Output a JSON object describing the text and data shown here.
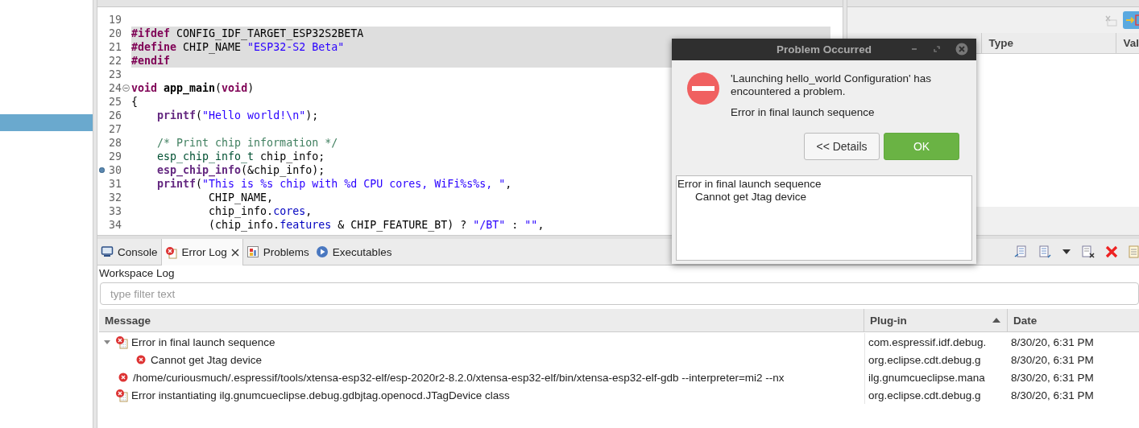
{
  "sidebar": {
    "rows": [
      {
        "selected": false
      },
      {
        "selected": false
      },
      {
        "selected": false
      },
      {
        "selected": false
      },
      {
        "selected": false
      },
      {
        "selected": false
      },
      {
        "selected": true
      }
    ]
  },
  "editor": {
    "lines": [
      {
        "number": "19",
        "highlighted": false
      },
      {
        "number": "20",
        "highlighted": true,
        "tokens": [
          {
            "kind": "keyword",
            "text": "#ifdef"
          },
          {
            "kind": "plain",
            "text": " CONFIG_IDF_TARGET_ESP32S2BETA"
          }
        ]
      },
      {
        "number": "21",
        "highlighted": true,
        "tokens": [
          {
            "kind": "keyword",
            "text": "#define"
          },
          {
            "kind": "plain",
            "text": " CHIP_NAME "
          },
          {
            "kind": "string",
            "text": "\"ESP32-S2 Beta\""
          }
        ]
      },
      {
        "number": "22",
        "highlighted": true,
        "tokens": [
          {
            "kind": "keyword",
            "text": "#endif"
          }
        ]
      },
      {
        "number": "23",
        "highlighted": false
      },
      {
        "number": "24",
        "highlighted": false,
        "collapsible": true,
        "tokens": [
          {
            "kind": "keyword",
            "text": "void"
          },
          {
            "kind": "decl",
            "text": " app_main"
          },
          {
            "kind": "plain",
            "text": "("
          },
          {
            "kind": "keyword",
            "text": "void"
          },
          {
            "kind": "plain",
            "text": ")"
          }
        ]
      },
      {
        "number": "25",
        "highlighted": false,
        "tokens": [
          {
            "kind": "plain",
            "text": "{"
          }
        ]
      },
      {
        "number": "26",
        "highlighted": false,
        "tokens": [
          {
            "kind": "func",
            "text": "    printf"
          },
          {
            "kind": "plain",
            "text": "("
          },
          {
            "kind": "string",
            "text": "\"Hello world!\\n\""
          },
          {
            "kind": "plain",
            "text": ");"
          }
        ]
      },
      {
        "number": "27",
        "highlighted": false
      },
      {
        "number": "28",
        "highlighted": false,
        "tokens": [
          {
            "kind": "comment",
            "text": "    /* Print chip information */"
          }
        ]
      },
      {
        "number": "29",
        "highlighted": false,
        "tokens": [
          {
            "kind": "type",
            "text": "    esp_chip_info_t"
          },
          {
            "kind": "plain",
            "text": " chip_info;"
          }
        ]
      },
      {
        "number": "30",
        "highlighted": false,
        "bookmark": true,
        "tokens": [
          {
            "kind": "func",
            "text": "    esp_chip_info"
          },
          {
            "kind": "plain",
            "text": "(&chip_info);"
          }
        ]
      },
      {
        "number": "31",
        "highlighted": false,
        "tokens": [
          {
            "kind": "func",
            "text": "    printf"
          },
          {
            "kind": "plain",
            "text": "("
          },
          {
            "kind": "string",
            "text": "\"This is %s chip with %d CPU cores, WiFi%s%s, \""
          },
          {
            "kind": "plain",
            "text": ","
          }
        ]
      },
      {
        "number": "32",
        "highlighted": false,
        "tokens": [
          {
            "kind": "plain",
            "text": "            CHIP_NAME,"
          }
        ]
      },
      {
        "number": "33",
        "highlighted": false,
        "tokens": [
          {
            "kind": "plain",
            "text": "            chip_info."
          },
          {
            "kind": "field",
            "text": "cores"
          },
          {
            "kind": "plain",
            "text": ","
          }
        ]
      },
      {
        "number": "34",
        "highlighted": false,
        "tokens": [
          {
            "kind": "plain",
            "text": "            (chip_info."
          },
          {
            "kind": "field",
            "text": "features"
          },
          {
            "kind": "plain",
            "text": " & CHIP_FEATURE_BT) ? "
          },
          {
            "kind": "string",
            "text": "\"/BT\""
          },
          {
            "kind": "plain",
            "text": " : "
          },
          {
            "kind": "string",
            "text": "\"\""
          },
          {
            "kind": "plain",
            "text": ","
          }
        ]
      }
    ]
  },
  "right_panel": {
    "columns": [
      "Type",
      "Val"
    ]
  },
  "bottom_panel": {
    "tabs": [
      {
        "label": "Console",
        "selected": false,
        "closable": false
      },
      {
        "label": "Error Log",
        "selected": true,
        "closable": true
      },
      {
        "label": "Problems",
        "selected": false,
        "closable": false
      },
      {
        "label": "Executables",
        "selected": false,
        "closable": false
      }
    ],
    "log_title": "Workspace Log",
    "filter": {
      "placeholder": "type filter text"
    },
    "columns": [
      {
        "label": "Message",
        "sorted": false
      },
      {
        "label": "Plug-in",
        "sorted": true
      },
      {
        "label": "Date",
        "sorted": false
      }
    ],
    "rows": [
      {
        "kind": "session",
        "message": "Error in final launch sequence",
        "plugin": "com.espressif.idf.debug.",
        "date": "8/30/20, 6:31 PM",
        "expanded": true,
        "children": [
          {
            "kind": "error",
            "message": "Cannot get Jtag device",
            "plugin": "org.eclipse.cdt.debug.g",
            "date": "8/30/20, 6:31 PM"
          }
        ]
      },
      {
        "kind": "error",
        "message": "/home/curiousmuch/.espressif/tools/xtensa-esp32-elf/esp-2020r2-8.2.0/xtensa-esp32-elf/bin/xtensa-esp32-elf-gdb --interpreter=mi2 --nx",
        "plugin": "ilg.gnumcueclipse.mana",
        "date": "8/30/20, 6:31 PM"
      },
      {
        "kind": "session",
        "message": "Error instantiating ilg.gnumcueclipse.debug.gdbjtag.openocd.JTagDevice class",
        "plugin": "org.eclipse.cdt.debug.g",
        "date": "8/30/20, 6:31 PM"
      }
    ]
  },
  "dialog": {
    "title": "Problem Occurred",
    "message": "'Launching hello_world Configuration' has encountered a problem.",
    "reason": "Error in final launch sequence",
    "buttons": [
      {
        "label": "<< Details",
        "kind": "secondary"
      },
      {
        "label": "OK",
        "kind": "primary"
      }
    ],
    "details": {
      "text": "Error in final launch sequence",
      "children": [
        {
          "text": "Cannot get Jtag device"
        }
      ]
    }
  }
}
